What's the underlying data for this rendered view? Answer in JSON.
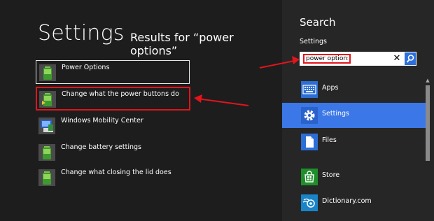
{
  "header": {
    "title": "Settings",
    "results_prefix": "Results for “power options”"
  },
  "results": [
    {
      "label": "Power Options",
      "icon": "battery-icon"
    },
    {
      "label": "Change what the power buttons do",
      "icon": "battery-icon"
    },
    {
      "label": "Windows Mobility Center",
      "icon": "mobility-center-icon"
    },
    {
      "label": "Change battery settings",
      "icon": "battery-icon"
    },
    {
      "label": "Change what closing the lid does",
      "icon": "battery-icon"
    }
  ],
  "search": {
    "title": "Search",
    "scope": "Settings",
    "query": "power options",
    "clear": "✕"
  },
  "apps": [
    {
      "label": "Apps"
    },
    {
      "label": "Settings",
      "selected": true
    },
    {
      "label": "Files"
    },
    {
      "label": "Store"
    },
    {
      "label": "Dictionary.com"
    }
  ],
  "scroll_up": "▲",
  "colors": {
    "accent": "#3b77e6",
    "highlight_red": "#e3141b",
    "pane_bg": "#262626",
    "results_bg": "#1d1d1d"
  }
}
